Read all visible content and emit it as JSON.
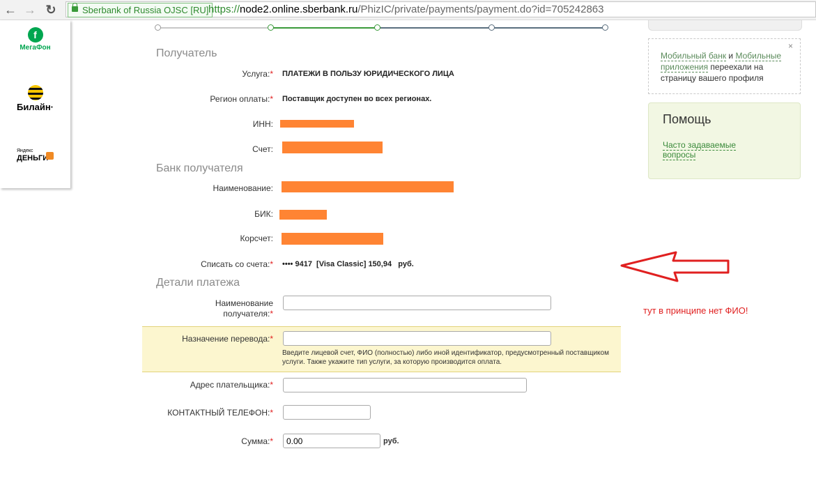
{
  "browser": {
    "back_icon": "←",
    "forward_icon": "→",
    "reload_icon": "↻",
    "page_icon": "page-icon",
    "security_label": "Sberbank of Russia  OJSC [RU]",
    "url_scheme": "https://",
    "url_host": "node2.online.sberbank.ru",
    "url_path": "/PhizIC/private/payments/payment.do?id=705242863"
  },
  "sidebar_logos": {
    "megafon_label": "МегаФон",
    "megafon_mark": "f",
    "beeline_label": "Билайн·",
    "yandex_small": "Яндекс",
    "yandex_label": "ДЕНЬГИ"
  },
  "stepper": {
    "colors": {
      "done": "#3a9a3a",
      "pending": "#5a6e7e",
      "inactive": "#c8c8c8"
    }
  },
  "recipient": {
    "section_title": "Получатель",
    "service_label": "Услуга:",
    "service_value": "ПЛАТЕЖИ В ПОЛЬЗУ ЮРИДИЧЕСКОГО ЛИЦА",
    "region_label": "Регион оплаты:",
    "region_value": "Поставщик доступен во всех регионах.",
    "inn_label": "ИНН:",
    "account_label": "Счет:"
  },
  "bank": {
    "section_title": "Банк получателя",
    "name_label": "Наименование:",
    "bik_label": "БИК:",
    "corr_label": "Корсчет:",
    "redaction_color": "#ff8433"
  },
  "debit": {
    "label": "Списать со счета:",
    "value": "•••• 9417  [Visa Classic] 150,94   руб."
  },
  "details": {
    "section_title": "Детали платежа",
    "recipient_name_label_1": "Наименование",
    "recipient_name_label_2": "получателя:",
    "purpose_label": "Назначение перевода:",
    "purpose_hint": "Введите лицевой счет, ФИО (полностью) либо иной идентификатор, предусмотренный поставщиком услуги. Также укажите тип услуги, за которую производится оплата.",
    "address_label": "Адрес плательщика:",
    "phone_label": "КОНТАКТНЫЙ ТЕЛЕФОН:",
    "sum_label": "Сумма:",
    "sum_value": "0.00",
    "sum_unit": "руб.",
    "required_mark": "*"
  },
  "right_panel": {
    "notice_link1": "Мобильный банк",
    "notice_and": " и ",
    "notice_link2": "Мобильные приложения",
    "notice_rest": " переехали на страницу вашего профиля",
    "notice_close": "×",
    "help_title": "Помощь",
    "help_link": "Часто задаваемые вопросы"
  },
  "annotation": {
    "text": "тут в принципе нет ФИО!",
    "color": "#e02020"
  }
}
